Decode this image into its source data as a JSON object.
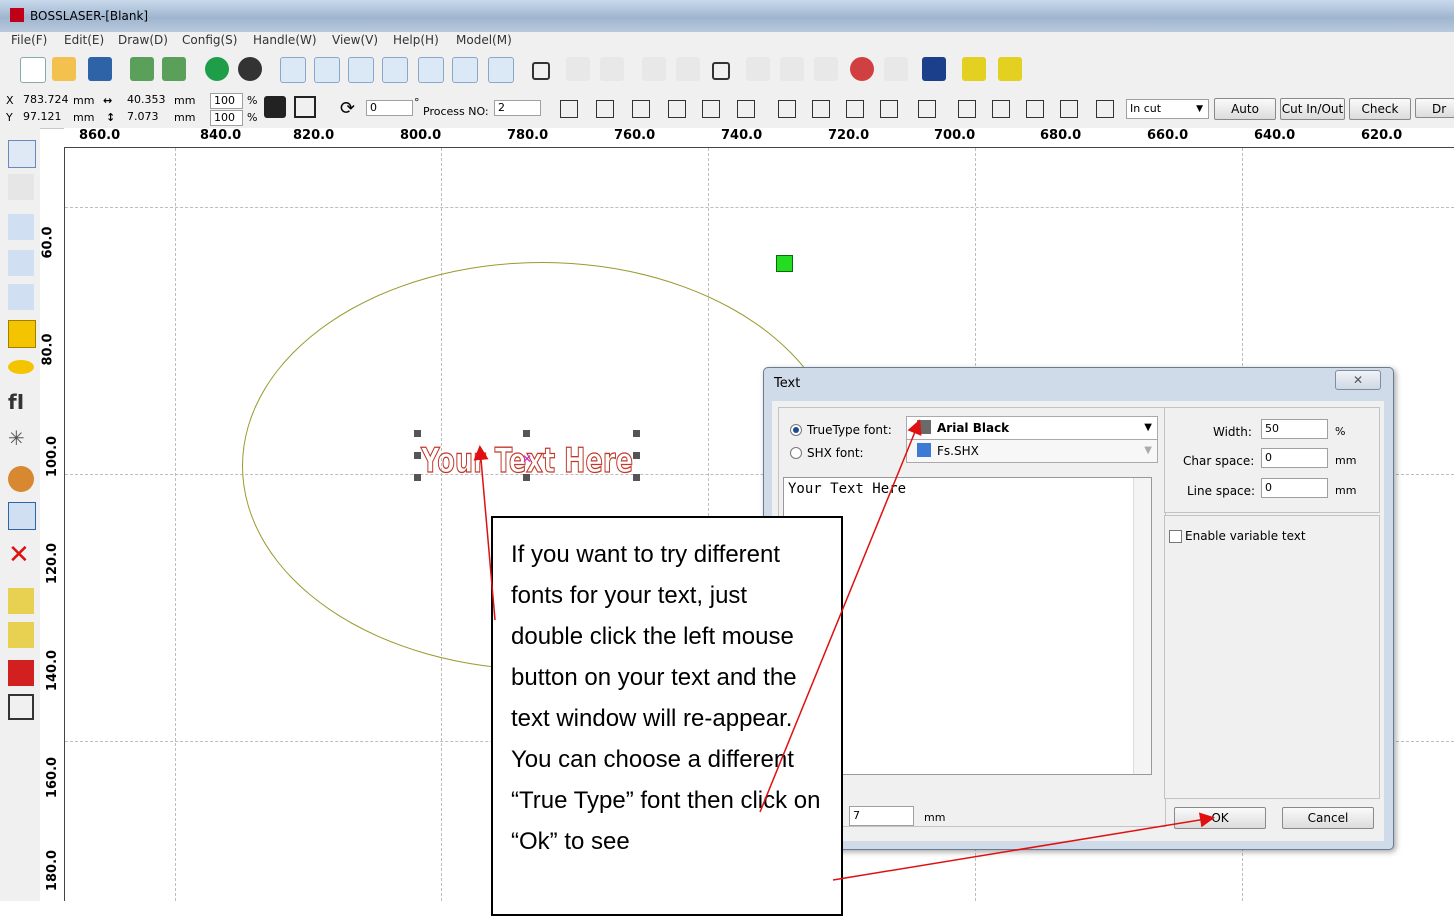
{
  "window": {
    "title": "BOSSLASER-[Blank]"
  },
  "menu": [
    "File(F)",
    "Edit(E)",
    "Draw(D)",
    "Config(S)",
    "Handle(W)",
    "View(V)",
    "Help(H)",
    "Model(M)"
  ],
  "coords": {
    "x_label": "X",
    "x_value": "783.724",
    "x_unit": "mm",
    "y_label": "Y",
    "y_value": "97.121",
    "y_unit": "mm",
    "width_value": "40.353",
    "width_unit": "mm",
    "height_value": "7.073",
    "height_unit": "mm",
    "scale_x": "100",
    "scale_y": "100",
    "scale_unit": "%",
    "rotate_value": "0",
    "rotate_unit": "°",
    "process_label": "Process NO:",
    "process_value": "2"
  },
  "toolbar2": {
    "cut_mode": "In cut",
    "auto": "Auto",
    "cut_inout": "Cut In/Out",
    "check": "Check",
    "draw": "Dr"
  },
  "ruler_h": [
    "860.0",
    "840.0",
    "820.0",
    "800.0",
    "780.0",
    "760.0",
    "740.0",
    "720.0",
    "700.0",
    "680.0",
    "660.0",
    "640.0",
    "620.0"
  ],
  "ruler_v": [
    "60.0",
    "80.0",
    "100.0",
    "120.0",
    "140.0",
    "160.0",
    "180.0"
  ],
  "canvas": {
    "sample_text": "Your Text Here",
    "accent_green": "#22dd22",
    "text_color": "#c0392b"
  },
  "dialog": {
    "title": "Text",
    "close": "✕",
    "truetype_label": "TrueType font:",
    "truetype_value": "Arial Black",
    "shx_label": "SHX font:",
    "shx_value": "Fs.SHX",
    "content": "Your Text Here",
    "width_label": "Width:",
    "width_value": "50",
    "width_unit": "%",
    "charspace_label": "Char space:",
    "charspace_value": "0",
    "charspace_unit": "mm",
    "linespace_label": "Line space:",
    "linespace_value": "0",
    "linespace_unit": "mm",
    "variable_label": "Enable variable text",
    "height_value": "7",
    "height_unit": "mm",
    "ok": "OK",
    "cancel": "Cancel"
  },
  "callout": {
    "text": "If you want to try different fonts for your text, just double click the left mouse button on your text and the text window will re-appear. You can choose a different “True Type” font then click on “Ok” to see"
  }
}
